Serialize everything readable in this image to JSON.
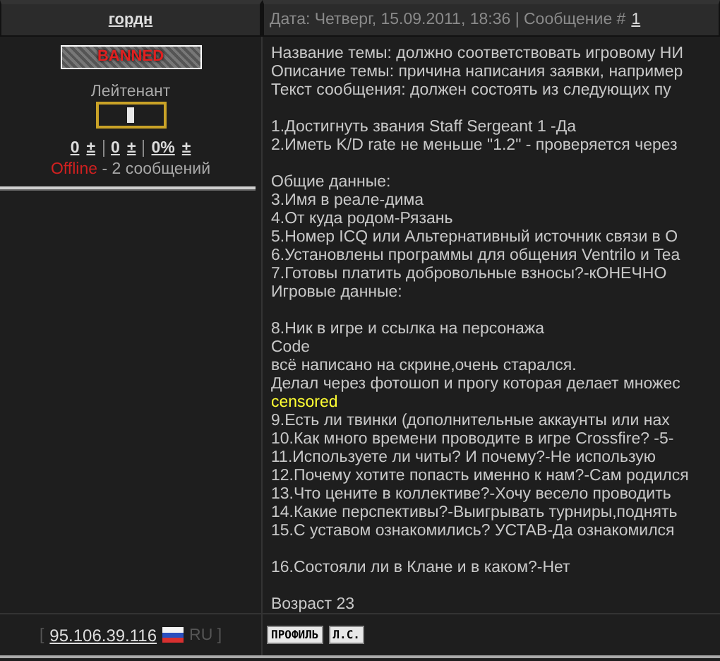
{
  "author": {
    "name": "гордн",
    "badge": "BANNED",
    "rank": "Лейтенант",
    "stats": [
      {
        "value": "0",
        "action": "±"
      },
      {
        "value": "0",
        "action": "±"
      },
      {
        "value": "0%",
        "action": "±"
      }
    ],
    "status": "Offline",
    "posts": "- 2 сообщений"
  },
  "header": {
    "date": "Дата: Четверг, 15.09.2011, 18:36 | Сообщение #",
    "number": "1"
  },
  "lines": [
    {
      "kind": "text",
      "text": "Название темы: должно соответствовать игровому НИ"
    },
    {
      "kind": "text",
      "text": "Описание темы: причина написания заявки, например"
    },
    {
      "kind": "text",
      "text": "Текст сообщения: должен состоять из следующих пу"
    },
    {
      "kind": "blank"
    },
    {
      "kind": "text",
      "text": "1.Достигнуть звания Staff Sergeant 1 -Да"
    },
    {
      "kind": "text",
      "text": "2.Иметь K/D rate не меньше \"1.2\" - проверяется через"
    },
    {
      "kind": "blank"
    },
    {
      "kind": "text",
      "text": "Общие данные:"
    },
    {
      "kind": "text",
      "text": "3.Имя в реале-дима"
    },
    {
      "kind": "text",
      "text": "4.От куда родом-Рязань"
    },
    {
      "kind": "text",
      "text": "5.Номер ICQ или Альтернативный источник связи в О"
    },
    {
      "kind": "text",
      "text": "6.Установлены программы для общения Ventrilo и Tea"
    },
    {
      "kind": "text",
      "text": "7.Готовы платить добровольные взносы?-кОНЕЧНО"
    },
    {
      "kind": "text",
      "text": "Игровые данные:"
    },
    {
      "kind": "blank"
    },
    {
      "kind": "text",
      "text": "8.Ник в игре и ссылка на персонажа"
    },
    {
      "kind": "text",
      "text": "Code"
    },
    {
      "kind": "text",
      "text": "всё написано на скрине,очень старался."
    },
    {
      "kind": "text",
      "text": "Делал через фотошоп и прогу которая делает множес"
    },
    {
      "kind": "highlight",
      "text": "censored"
    },
    {
      "kind": "text",
      "text": "9.Есть ли твинки (дополнительные аккаунты или нах"
    },
    {
      "kind": "text",
      "text": "10.Как много времени проводите в игре Crossfire? -5-"
    },
    {
      "kind": "text",
      "text": "11.Используете ли читы? И почему?-Не использую"
    },
    {
      "kind": "text",
      "text": "12.Почему хотите попасть именно к нам?-Сам родился"
    },
    {
      "kind": "text",
      "text": "13.Что цените в коллективе?-Хочу весело проводить"
    },
    {
      "kind": "text",
      "text": "14.Какие перспективы?-Выигрывать турниры,поднять"
    },
    {
      "kind": "text",
      "text": "15.С уставом ознакомились? УСТАВ-Да ознакомился"
    },
    {
      "kind": "blank"
    },
    {
      "kind": "text",
      "text": "16.Состояли ли в Клане и в каком?-Нет"
    },
    {
      "kind": "blank"
    },
    {
      "kind": "text",
      "text": "Возраст 23"
    }
  ],
  "footer": {
    "open": "[",
    "ip": "95.106.39.116",
    "country": "RU ]",
    "buttons": [
      "ПРОФИЛЬ",
      "Л.С."
    ]
  }
}
